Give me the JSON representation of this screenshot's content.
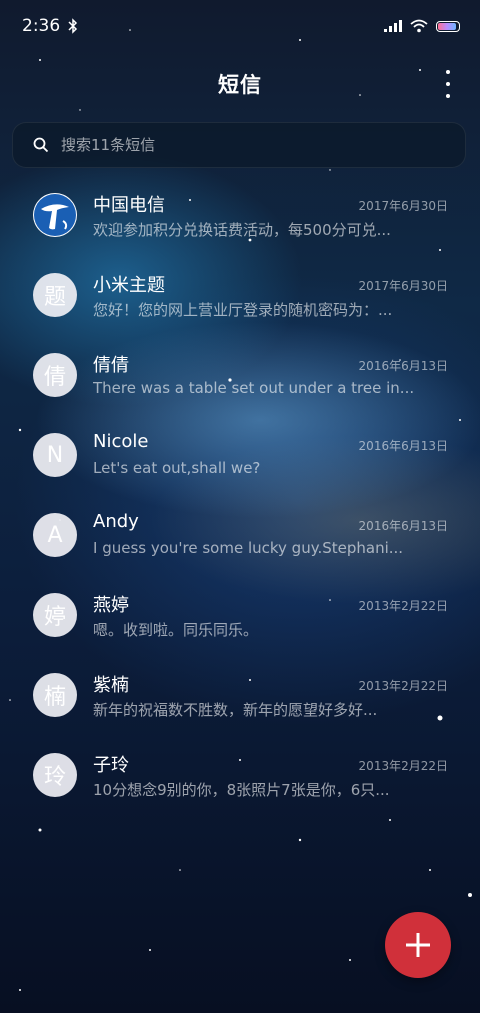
{
  "status_bar": {
    "time": "2:36",
    "battery_level": 0.9,
    "icons": [
      "bluetooth-icon",
      "signal-icon",
      "wifi-icon",
      "battery-icon"
    ]
  },
  "header": {
    "title": "短信",
    "menu_icon": "more-vert-icon"
  },
  "search": {
    "placeholder": "搜索11条短信",
    "value": ""
  },
  "messages": [
    {
      "name": "中国电信",
      "date": "2017年6月30日",
      "preview": "欢迎参加积分兑换话费活动，每500分可兑...",
      "avatar": "",
      "avatar_type": "china-telecom-logo"
    },
    {
      "name": "小米主题",
      "date": "2017年6月30日",
      "preview": "您好！您的网上营业厅登录的随机密码为：...",
      "avatar": "题"
    },
    {
      "name": "倩倩",
      "date": "2016年6月13日",
      "preview": "There was a table set out under a tree in...",
      "avatar": "倩"
    },
    {
      "name": "Nicole",
      "date": "2016年6月13日",
      "preview": "Let's eat out,shall we?",
      "avatar": "N"
    },
    {
      "name": "Andy",
      "date": "2016年6月13日",
      "preview": "I guess you're some lucky guy.Stephani...",
      "avatar": "A"
    },
    {
      "name": "燕婷",
      "date": "2013年2月22日",
      "preview": "嗯。收到啦。同乐同乐。",
      "avatar": "婷"
    },
    {
      "name": "紫楠",
      "date": "2013年2月22日",
      "preview": "新年的祝福数不胜数，新年的愿望好多好...",
      "avatar": "楠"
    },
    {
      "name": "子玲",
      "date": "2013年2月22日",
      "preview": "10分想念9别的你，8张照片7张是你，6只...",
      "avatar": "玲"
    }
  ],
  "fab": {
    "icon": "plus-icon",
    "color": "#d0303a"
  }
}
